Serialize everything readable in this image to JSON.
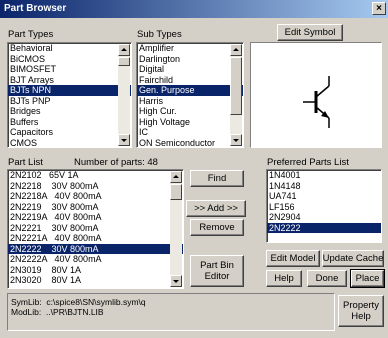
{
  "window": {
    "title": "Part Browser",
    "close_label": "×"
  },
  "part_types": {
    "label": "Part Types",
    "items": [
      "Behavioral",
      "BiCMOS",
      "BIMOSFET",
      "BJT Arrays",
      "BJTs NPN",
      "BJTs PNP",
      "Bridges",
      "Buffers",
      "Capacitors",
      "CMOS"
    ],
    "selected": "BJTs NPN"
  },
  "sub_types": {
    "label": "Sub Types",
    "items": [
      "Amplifier",
      "Darlington",
      "Digital",
      "Fairchild",
      "Gen. Purpose",
      "Harris",
      "High Cur.",
      "High Voltage",
      "IC",
      "ON Semiconductor"
    ],
    "selected": "Gen. Purpose"
  },
  "edit_symbol_label": "Edit Symbol",
  "part_list": {
    "label": "Part List",
    "count_label": "Number of parts: 48",
    "items": [
      "2N2102   65V 1A",
      "2N2218    30V 800mA",
      "2N2218A   40V 800mA",
      "2N2219    30V 800mA",
      "2N2219A   40V 800mA",
      "2N2221    30V 800mA",
      "2N2221A   40V 800mA",
      "2N2222    30V 800mA",
      "2N2222A   40V 800mA",
      "2N3019    80V 1A",
      "2N3020    80V 1A"
    ],
    "selected": "2N2222    30V 800mA"
  },
  "buttons": {
    "find": "Find",
    "add": ">> Add >>",
    "remove": "Remove",
    "part_bin_editor_1": "Part Bin",
    "part_bin_editor_2": "Editor",
    "edit_model": "Edit Model",
    "update_cache": "Update Cache",
    "help": "Help",
    "done": "Done",
    "place": "Place",
    "property_help_1": "Property",
    "property_help_2": "Help"
  },
  "preferred_parts": {
    "label": "Preferred Parts List",
    "items": [
      "1N4001",
      "1N4148",
      "UA741",
      "LF156",
      "2N2904",
      "2N2222"
    ],
    "selected": "2N2222"
  },
  "status": {
    "symlib": "SymLib:  c:\\spice8\\SN\\symlib.sym\\q",
    "modlib": "ModLib:  ..\\PR\\BJTN.LIB"
  }
}
